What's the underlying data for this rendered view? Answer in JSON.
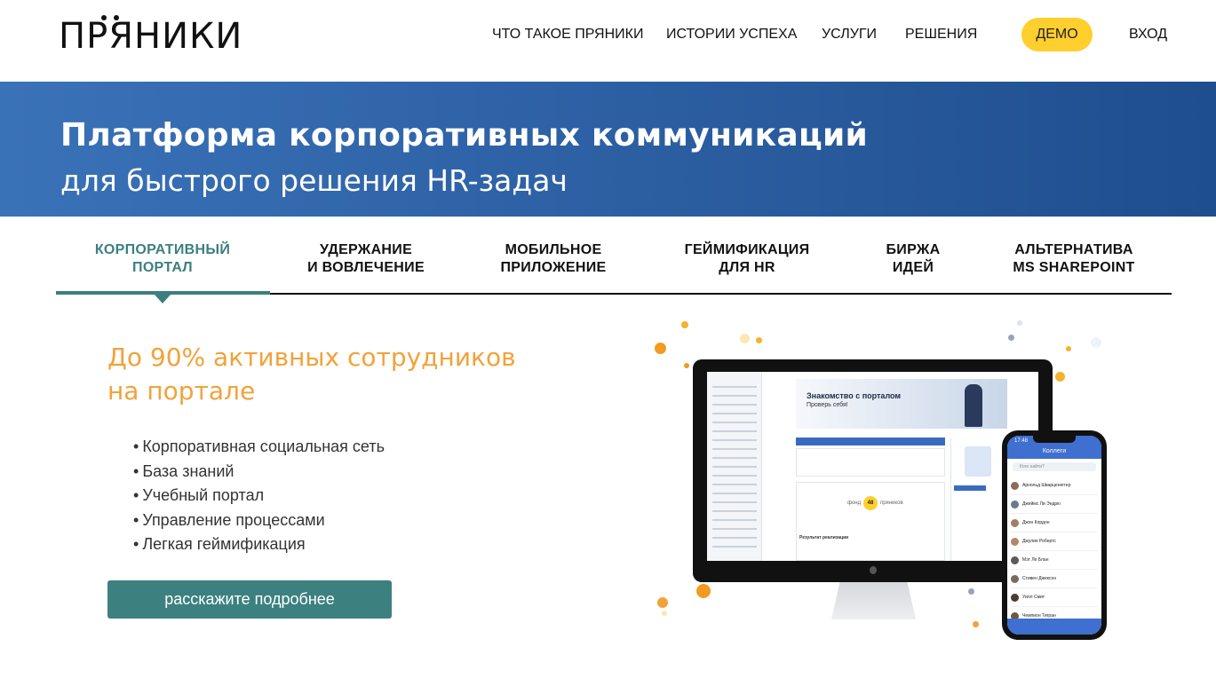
{
  "header": {
    "logo": "ПРЯНИКИ",
    "nav": [
      "ЧТО ТАКОЕ ПРЯНИКИ",
      "ИСТОРИИ УСПЕХА",
      "УСЛУГИ",
      "РЕШЕНИЯ"
    ],
    "demo": "ДЕМО",
    "login": "ВХОД"
  },
  "banner": {
    "title": "Платформа корпоративных коммуникаций",
    "subtitle": "для быстрого решения HR-задач"
  },
  "tabs": [
    {
      "line1": "КОРПОРАТИВНЫЙ",
      "line2": "ПОРТАЛ",
      "active": true
    },
    {
      "line1": "УДЕРЖАНИЕ",
      "line2": "И ВОВЛЕЧЕНИЕ",
      "active": false
    },
    {
      "line1": "МОБИЛЬНОЕ",
      "line2": "ПРИЛОЖЕНИЕ",
      "active": false
    },
    {
      "line1": "ГЕЙМИФИКАЦИЯ",
      "line2": "ДЛЯ HR",
      "active": false
    },
    {
      "line1": "БИРЖА",
      "line2": "ИДЕЙ",
      "active": false
    },
    {
      "line1": "АЛЬТЕРНАТИВА",
      "line2": "MS SHAREPOINT",
      "active": false
    }
  ],
  "content": {
    "headline_line1": "До 90% активных сотрудников",
    "headline_line2": "на портале",
    "bullets": [
      "Корпоративная социальная сеть",
      "База знаний",
      "Учебный портал",
      "Управление процессами",
      "Легкая геймификация"
    ],
    "cta": "расскажите подробнее"
  },
  "mockup": {
    "desktop_banner_title": "Знакомство с порталом",
    "desktop_banner_subtitle": "Проверь себя!",
    "desktop_coins": "48",
    "desktop_coins_label_left": "фонд",
    "desktop_coins_label_right": "пряников",
    "desktop_section": "Результат реализации",
    "phone_title": "Коллеги",
    "phone_time": "17:48",
    "phone_search": "Кого найти?",
    "phone_contacts": [
      "Арнольд Шварценеггер",
      "Джеймс Ли Эндрю",
      "Джон Кордон",
      "Джулия Робертс",
      "Мэт Ле Блан",
      "Стивен Джексон",
      "Уилл Смит",
      "Чемпион Тигран"
    ]
  },
  "colors": {
    "accent_teal": "#3d8080",
    "accent_orange": "#f2a23a",
    "demo_yellow": "#ffcf2e",
    "banner_blue": "#2f63a7"
  }
}
